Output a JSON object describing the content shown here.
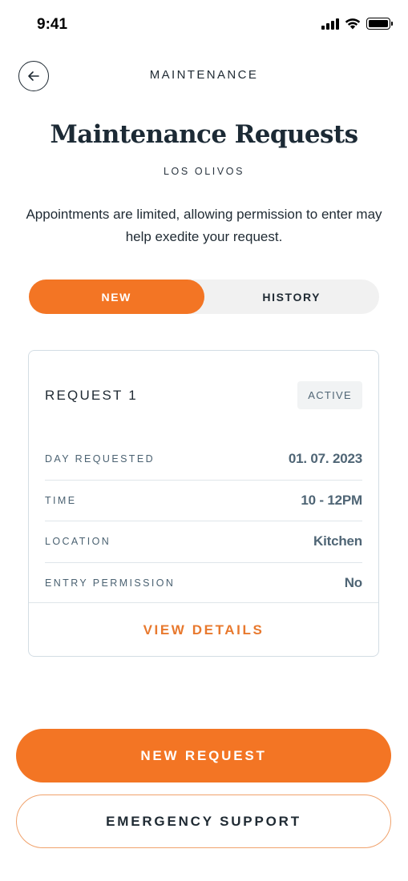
{
  "status_bar": {
    "time": "9:41"
  },
  "header": {
    "title": "MAINTENANCE"
  },
  "page": {
    "title": "Maintenance Requests",
    "property": "LOS OLIVOS",
    "info": "Appointments are limited, allowing permission to enter may help exedite your request."
  },
  "tabs": [
    {
      "label": "NEW",
      "active": true
    },
    {
      "label": "HISTORY",
      "active": false
    }
  ],
  "request": {
    "title": "REQUEST 1",
    "status": "ACTIVE",
    "rows": [
      {
        "label": "DAY REQUESTED",
        "value": "01. 07. 2023"
      },
      {
        "label": "TIME",
        "value": "10 - 12PM"
      },
      {
        "label": "LOCATION",
        "value": "Kitchen"
      },
      {
        "label": "ENTRY PERMISSION",
        "value": "No"
      }
    ],
    "action": "VIEW DETAILS"
  },
  "buttons": {
    "primary": "NEW REQUEST",
    "secondary": "EMERGENCY SUPPORT"
  },
  "colors": {
    "accent": "#f37524",
    "text_dark": "#1f2a33",
    "text_muted": "#4f6575"
  },
  "icons": {
    "back": "arrow-left-icon",
    "signal": "cellular-signal-icon",
    "wifi": "wifi-icon",
    "battery": "battery-icon"
  }
}
